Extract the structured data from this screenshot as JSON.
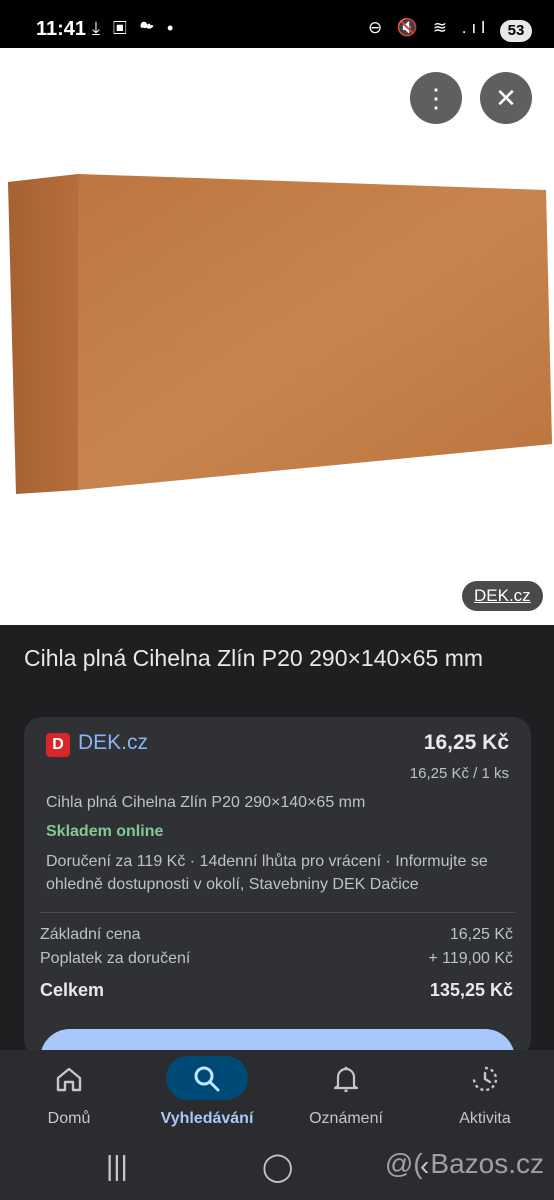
{
  "status_bar": {
    "time": "11:41",
    "left_icons": "⤓ ▣ ☁ •",
    "right_icons": "⊖ 🔇 ≋ .ıl",
    "battery": "53"
  },
  "image_viewer": {
    "menu_icon": "more-vert-icon",
    "close_icon": "close-icon",
    "source_chip": "DEK.cz"
  },
  "product": {
    "title": "Cihla plná Cihelna Zlín P20 290×140×65 mm"
  },
  "offer": {
    "seller_logo_letter": "D",
    "seller_name": "DEK.cz",
    "price": "16,25 Kč",
    "unit_price": "16,25 Kč / 1 ks",
    "description": "Cihla plná Cihelna Zlín P20 290×140×65 mm",
    "stock": "Skladem online",
    "delivery": "Doručení za 119 Kč · 14denní lhůta pro vrácení · Informujte se ohledně dostupnosti v okolí, Stavebniny DEK Dačice",
    "rows": [
      {
        "label": "Základní cena",
        "value": "16,25 Kč"
      },
      {
        "label": "Poplatek za doručení",
        "value": "+ 119,00 Kč"
      },
      {
        "label": "Celkem",
        "value": "135,25 Kč"
      }
    ]
  },
  "bottom_nav": {
    "items": [
      {
        "label": "Domů",
        "icon": "home-icon"
      },
      {
        "label": "Vyhledávání",
        "icon": "search-icon"
      },
      {
        "label": "Oznámení",
        "icon": "bell-icon"
      },
      {
        "label": "Aktivita",
        "icon": "activity-icon"
      }
    ]
  },
  "watermark": "@( Bazos.cz",
  "colors": {
    "background": "#1f1f21",
    "card": "#303134",
    "link": "#8ab4f8",
    "stock_green": "#81c995",
    "accent": "#a8c7fa"
  }
}
